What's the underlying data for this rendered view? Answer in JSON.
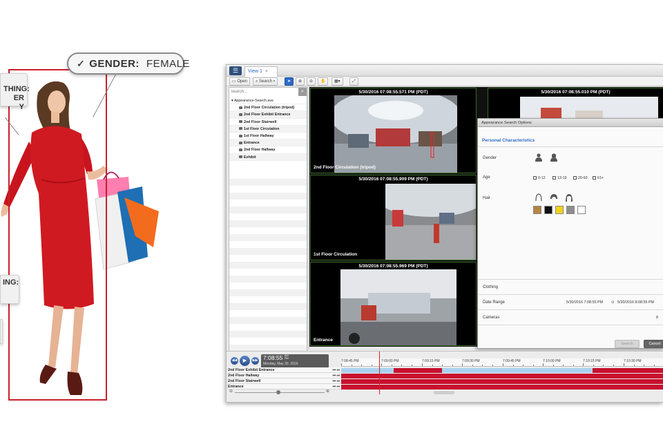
{
  "callouts": {
    "gender_key": "GENDER:",
    "gender_value": "FEMALE",
    "clothing_top": "THING:\nER\nY",
    "clothing_bottom": "ING:"
  },
  "app": {
    "tab_label": "View 1",
    "toolbar": {
      "open": "Open",
      "search": "Search"
    },
    "search_placeholder": "Search...",
    "tree": {
      "root": "Appearance-Search.ave",
      "items": [
        "2nd Floor Circulation (tripod)",
        "2nd Floor Exhibit Entrance",
        "2nd Floor Stairwell",
        "1st Floor Circulation",
        "1st Floor Hallway",
        "Entrance",
        "2nd Floor Hallway",
        "Exhibit"
      ]
    },
    "tiles": [
      {
        "timestamp": "5/30/2016 07:08:55.571 PM (PDT)",
        "label": "2nd Floor Circulation (tripod)"
      },
      {
        "timestamp": "5/30/2016 07:08:55.010 PM (PDT)",
        "label": ""
      },
      {
        "timestamp": "5/30/2016 07:08:55.909 PM (PDT)",
        "label": "1st Floor Circulation"
      },
      {
        "timestamp": "5/30/2016 07:08:55.969 PM (PDT)",
        "label": "Entrance"
      }
    ],
    "appearance_search": {
      "title": "Appearance Search Options",
      "section": "Personal Characteristics",
      "gender_label": "Gender",
      "age_label": "Age",
      "age_options": [
        "0-12",
        "13-19",
        "20-60",
        "61+"
      ],
      "hair_label": "Hair",
      "hair_colors": [
        "#b5863f",
        "#111111",
        "#f2d21b",
        "#8e8e8e",
        "#ffffff"
      ],
      "clothing_label": "Clothing",
      "date_range_label": "Date Range",
      "date_from": "5/30/2016 7:08:55 PM",
      "date_to": "5/30/2016 8:08:55 PM",
      "cameras_label": "Cameras",
      "cameras_count": "8",
      "search_button": "Search",
      "cancel_button": "Cancel"
    },
    "timeline": {
      "clock_time": "7:08:55",
      "clock_ampm": "AM\nPM",
      "clock_date": "Monday, May 30, 2016",
      "ticks": [
        "7:08:45 PM",
        "7:09:00 PM",
        "7:09:15 PM",
        "7:09:30 PM",
        "7:09:45 PM",
        "7:10:00 PM",
        "7:10:15 PM",
        "7:10:30 PM"
      ],
      "cameras": [
        "2nd Floor Exhibit Entrance",
        "2nd Floor Hallway",
        "2nd Floor Stairwell",
        "Entrance"
      ]
    }
  },
  "colors": {
    "accent_blue": "#2e6cc8",
    "recording_red": "#c8102e",
    "motion_blue": "#a9d2ee",
    "box_red": "#c8202a"
  }
}
